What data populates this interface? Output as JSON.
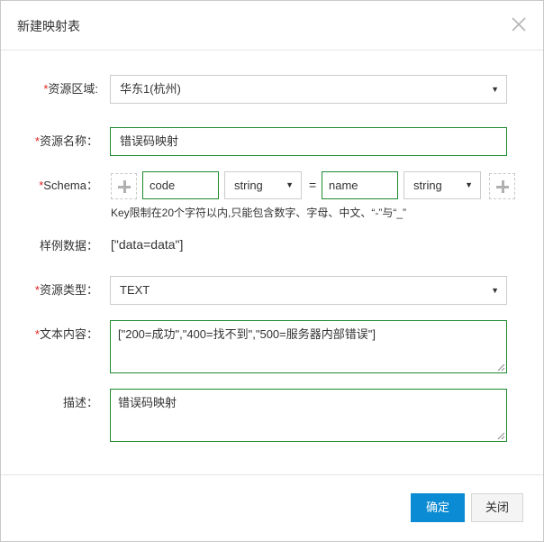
{
  "dialog": {
    "title": "新建映射表"
  },
  "form": {
    "region": {
      "required_mark": "*",
      "label": "资源区域:",
      "value": "华东1(杭州)"
    },
    "name": {
      "required_mark": "*",
      "label": "资源名称：",
      "value": "错误码映射"
    },
    "schema": {
      "required_mark": "*",
      "label": "Schema：",
      "key_input": "code",
      "key_type": "string",
      "equals": "=",
      "value_input": "name",
      "value_type": "string",
      "hint": "Key限制在20个字符以内,只能包含数字、字母、中文、“-”与“_”"
    },
    "sample": {
      "label": "样例数据：",
      "value": "[\"data=data\"]"
    },
    "type": {
      "required_mark": "*",
      "label": "资源类型：",
      "value": "TEXT"
    },
    "content": {
      "required_mark": "*",
      "label": "文本内容：",
      "value": "[\"200=成功\",\"400=找不到\",\"500=服务器内部错误\"]"
    },
    "description": {
      "label": "描述：",
      "value": "错误码映射"
    }
  },
  "footer": {
    "confirm_label": "确定",
    "close_label": "关闭"
  },
  "icons": {
    "close": "close-icon",
    "dropdown": "caret-down-icon",
    "add": "plus-icon"
  },
  "colors": {
    "primary": "#0b8bd3",
    "required": "#e0211f",
    "valid_border": "#1f8a2f",
    "border": "#cccccc"
  }
}
